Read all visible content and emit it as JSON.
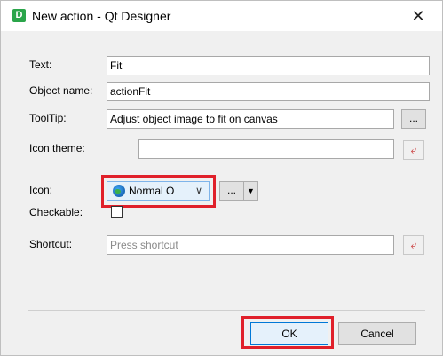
{
  "window": {
    "app_icon_letter": "D",
    "title": "New action - Qt Designer",
    "close_glyph": "✕"
  },
  "form": {
    "text_label": "Text:",
    "text_value": "Fit",
    "object_name_label": "Object name:",
    "object_name_value": "actionFit",
    "tooltip_label": "ToolTip:",
    "tooltip_value": "Adjust object image to fit on canvas",
    "tooltip_more": "...",
    "icon_theme_label": "Icon theme:",
    "icon_theme_value": "",
    "icon_label": "Icon:",
    "icon_mode": "Normal O",
    "icon_more": "...",
    "checkable_label": "Checkable:",
    "checkable_checked": false,
    "shortcut_label": "Shortcut:",
    "shortcut_placeholder": "Press shortcut"
  },
  "buttons": {
    "ok": "OK",
    "cancel": "Cancel"
  },
  "colors": {
    "highlight_box": "#e0202a",
    "app_icon": "#2aa54a",
    "reset_icon": "#c83232"
  },
  "icons": {
    "reset": "reset-arrow-icon",
    "globe": "globe-icon",
    "dropdown": "chevron-down-icon"
  }
}
